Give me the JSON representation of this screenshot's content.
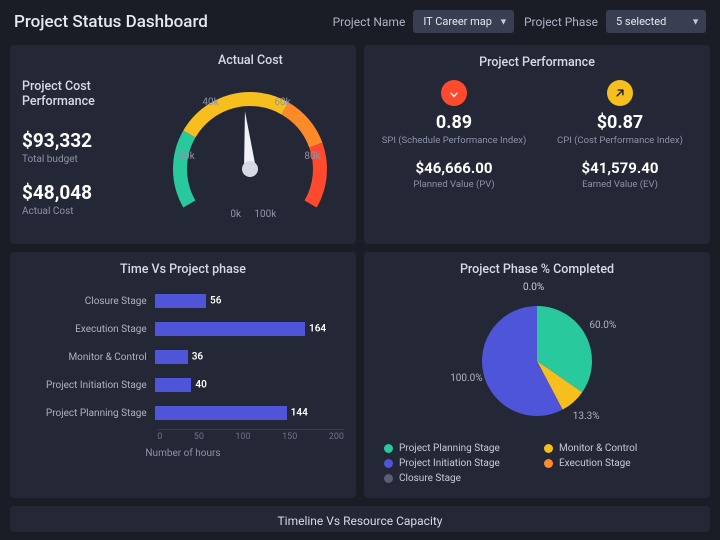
{
  "header": {
    "title": "Project Status Dashboard",
    "filters": {
      "project_name_label": "Project Name",
      "project_name_value": "IT Career map",
      "project_phase_label": "Project Phase",
      "project_phase_value": "5 selected"
    }
  },
  "cost_card": {
    "title": "Project Cost Performance",
    "gauge_title": "Actual Cost",
    "total_budget_value": "$93,332",
    "total_budget_label": "Total budget",
    "actual_cost_value": "$48,048",
    "actual_cost_label": "Actual Cost",
    "gauge": {
      "min": 0,
      "max": 100000,
      "value": 48048,
      "ticks": [
        "0k",
        "20k",
        "40k",
        "60k",
        "80k",
        "100k"
      ]
    }
  },
  "perf_card": {
    "title": "Project Performance",
    "spi": {
      "value": "0.89",
      "label": "SPI (Schedule Performance Index)",
      "status": "bad"
    },
    "cpi": {
      "value": "$0.87",
      "label": "CPI (Cost Performance Index)",
      "status": "good"
    },
    "planned": {
      "value": "$46,666.00",
      "label": "Planned Value (PV)"
    },
    "earned": {
      "value": "$41,579.40",
      "label": "Earned Value (EV)"
    }
  },
  "bar_card": {
    "title": "Time Vs Project phase",
    "xlabel": "Number of hours",
    "xmax": 200,
    "xticks": [
      "0",
      "50",
      "100",
      "150",
      "200"
    ]
  },
  "pie_card": {
    "title": "Project Phase % Completed"
  },
  "bottom": {
    "title": "Timeline Vs Resource Capacity"
  },
  "palette": {
    "green": "#28c99d",
    "yellow": "#f6bf1e",
    "orange": "#ff8a2a",
    "red": "#ff4a2e",
    "blue": "#4f55d8",
    "grey": "#5a5f77"
  },
  "chart_data": [
    {
      "type": "gauge",
      "title": "Actual Cost",
      "min": 0,
      "max": 100000,
      "value": 48048,
      "tick_labels": [
        "0k",
        "20k",
        "40k",
        "60k",
        "80k",
        "100k"
      ],
      "segments": [
        {
          "from": 0,
          "to": 33000,
          "color": "#28c99d"
        },
        {
          "from": 33000,
          "to": 66000,
          "color": "#f6bf1e"
        },
        {
          "from": 66000,
          "to": 83000,
          "color": "#ff8a2a"
        },
        {
          "from": 83000,
          "to": 100000,
          "color": "#ff4a2e"
        }
      ]
    },
    {
      "type": "bar",
      "orientation": "horizontal",
      "title": "Time Vs Project phase",
      "xlabel": "Number of hours",
      "xlim": [
        0,
        200
      ],
      "categories": [
        "Closure Stage",
        "Execution Stage",
        "Monitor & Control",
        "Project Initiation Stage",
        "Project Planning Stage"
      ],
      "values": [
        56,
        164,
        36,
        40,
        144
      ],
      "color": "#4f55d8"
    },
    {
      "type": "pie",
      "title": "Project Phase % Completed",
      "series": [
        {
          "name": "Project Planning Stage",
          "value": 60.0,
          "color": "#28c99d"
        },
        {
          "name": "Monitor & Control",
          "value": 13.3,
          "color": "#f6bf1e"
        },
        {
          "name": "Project Initiation Stage",
          "value": 100.0,
          "color": "#4f55d8"
        },
        {
          "name": "Execution Stage",
          "value": 0.0,
          "color": "#ff8a2a"
        },
        {
          "name": "Closure Stage",
          "value": 0.0,
          "color": "#5a5f77"
        }
      ]
    }
  ]
}
